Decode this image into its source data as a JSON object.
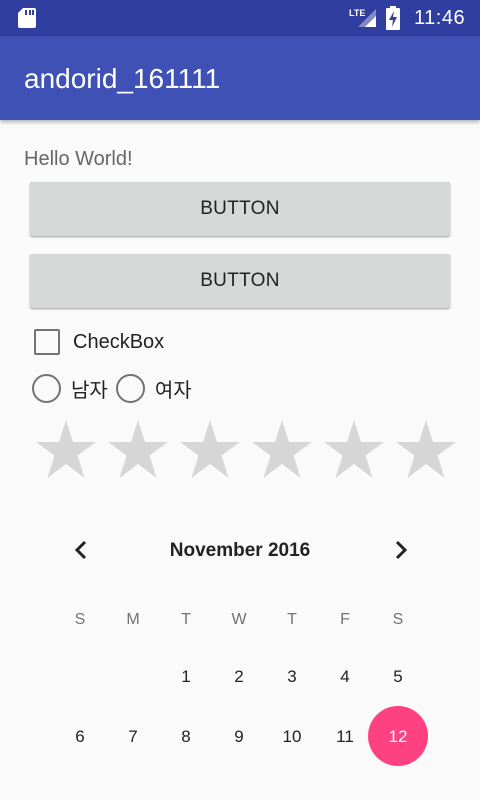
{
  "status_bar": {
    "time": "11:46",
    "network": "LTE"
  },
  "app_bar": {
    "title": "andorid_161111"
  },
  "hello_text": "Hello World!",
  "buttons": [
    "BUTTON",
    "BUTTON"
  ],
  "checkbox": {
    "label": "CheckBox",
    "checked": false
  },
  "radios": [
    {
      "label": "남자",
      "checked": false
    },
    {
      "label": "여자",
      "checked": false
    }
  ],
  "rating": {
    "max": 6,
    "value": 0
  },
  "calendar": {
    "month_title": "November 2016",
    "weekdays": [
      "S",
      "M",
      "T",
      "W",
      "T",
      "F",
      "S"
    ],
    "week1": [
      "",
      "",
      "1",
      "2",
      "3",
      "4",
      "5"
    ],
    "week2": [
      "6",
      "7",
      "8",
      "9",
      "10",
      "11",
      "12"
    ],
    "selected_day": "12",
    "accent": "#ff4081"
  },
  "colors": {
    "primary": "#3f51b5",
    "primary_dark": "#303f9f",
    "star_empty": "#d6d6d6"
  }
}
